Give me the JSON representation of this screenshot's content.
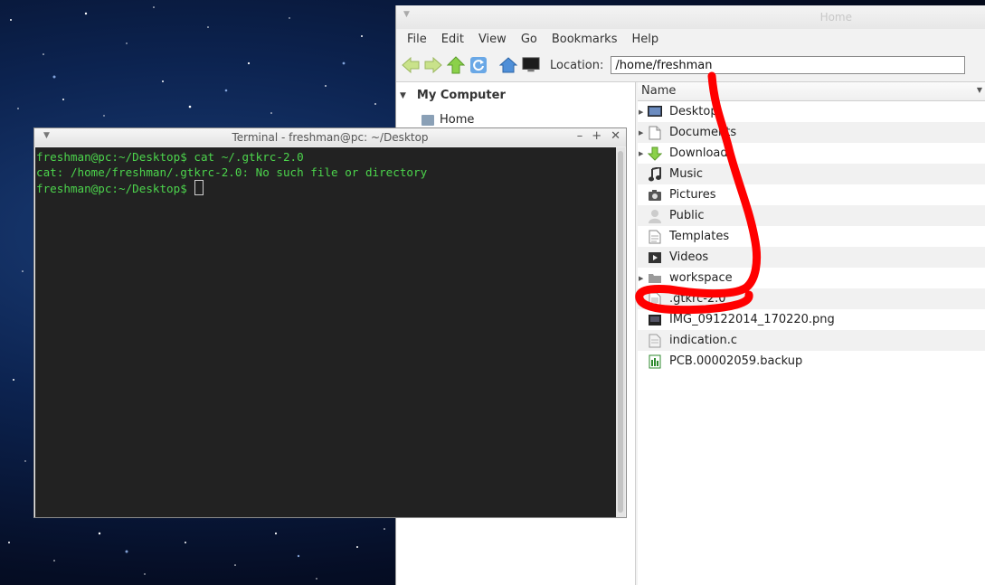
{
  "file_manager": {
    "window_title": "Home",
    "menu": [
      "File",
      "Edit",
      "View",
      "Go",
      "Bookmarks",
      "Help"
    ],
    "toolbar": {
      "location_label": "Location:",
      "location_value": "/home/freshman"
    },
    "sidebar": {
      "header": "My Computer",
      "items": [
        {
          "label": "Home"
        }
      ]
    },
    "list": {
      "column_name": "Name",
      "items": [
        {
          "name": "Desktop",
          "icon": "desktop-folder-icon",
          "expandable": true
        },
        {
          "name": "Documents",
          "icon": "documents-folder-icon",
          "expandable": true
        },
        {
          "name": "Downloads",
          "icon": "downloads-folder-icon",
          "expandable": true
        },
        {
          "name": "Music",
          "icon": "music-folder-icon",
          "expandable": false
        },
        {
          "name": "Pictures",
          "icon": "pictures-folder-icon",
          "expandable": false
        },
        {
          "name": "Public",
          "icon": "public-folder-icon",
          "expandable": false
        },
        {
          "name": "Templates",
          "icon": "templates-folder-icon",
          "expandable": false
        },
        {
          "name": "Videos",
          "icon": "videos-folder-icon",
          "expandable": false
        },
        {
          "name": "workspace",
          "icon": "folder-icon",
          "expandable": true
        },
        {
          "name": ".gtkrc-2.0",
          "icon": "text-file-icon",
          "expandable": false
        },
        {
          "name": "IMG_09122014_170220.png",
          "icon": "image-file-icon",
          "expandable": false
        },
        {
          "name": "indication.c",
          "icon": "c-source-file-icon",
          "expandable": false
        },
        {
          "name": "PCB.00002059.backup",
          "icon": "backup-file-icon",
          "expandable": false
        }
      ]
    }
  },
  "terminal": {
    "window_title": "Terminal - freshman@pc: ~/Desktop",
    "lines": [
      "freshman@pc:~/Desktop$ cat ~/.gtkrc-2.0",
      "cat: /home/freshman/.gtkrc-2.0: No such file or directory",
      "freshman@pc:~/Desktop$ "
    ]
  },
  "colors": {
    "terminal_text": "#4cd44c",
    "terminal_bg": "#222222",
    "annotation": "#ff0000"
  }
}
